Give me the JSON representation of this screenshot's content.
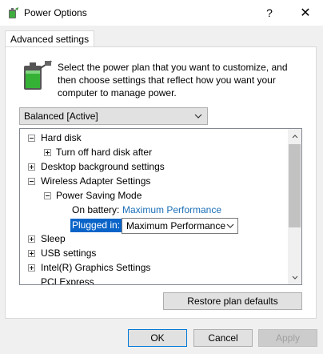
{
  "window": {
    "title": "Power Options",
    "help_glyph": "?",
    "close_glyph": "✕"
  },
  "tabs": [
    {
      "label": "Advanced settings"
    }
  ],
  "description": "Select the power plan that you want to customize, and then choose settings that reflect how you want your computer to manage power.",
  "plan_select": {
    "value": "Balanced [Active]"
  },
  "tree": {
    "items": [
      {
        "label": "Hard disk",
        "expanded": true
      },
      {
        "label": "Turn off hard disk after",
        "expanded": false
      },
      {
        "label": "Desktop background settings",
        "expanded": false
      },
      {
        "label": "Wireless Adapter Settings",
        "expanded": true
      },
      {
        "label": "Power Saving Mode",
        "expanded": true
      },
      {
        "label": "On battery:",
        "value": "Maximum Performance"
      },
      {
        "label": "Plugged in:",
        "value": "Maximum Performance"
      },
      {
        "label": "Sleep",
        "expanded": false
      },
      {
        "label": "USB settings",
        "expanded": false
      },
      {
        "label": "Intel(R) Graphics Settings",
        "expanded": false
      },
      {
        "label": "PCI Express",
        "expanded": false
      }
    ]
  },
  "buttons": {
    "restore": "Restore plan defaults",
    "ok": "OK",
    "cancel": "Cancel",
    "apply": "Apply"
  },
  "colors": {
    "accent": "#0078d7",
    "link": "#1a6fb7",
    "selection": "#0a64c8"
  }
}
